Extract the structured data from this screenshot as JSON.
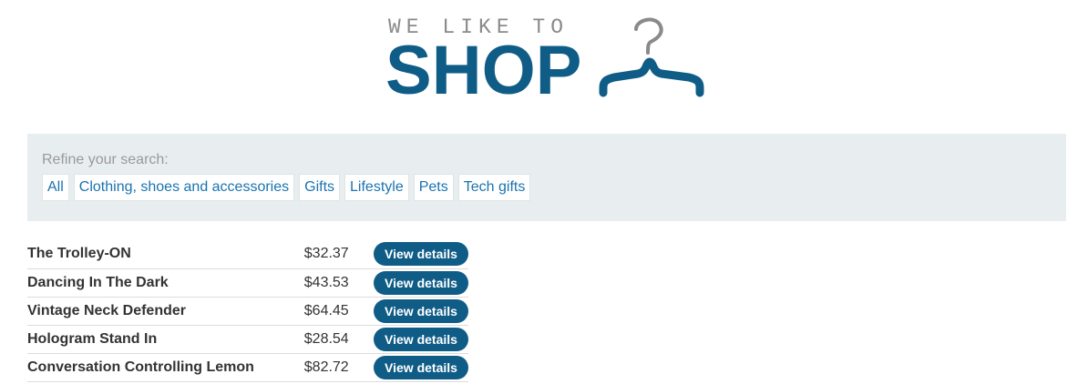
{
  "logo": {
    "tagline": "WE LIKE TO",
    "word": "SHOP",
    "icon": "hanger-icon",
    "colors": {
      "tagline": "#8a8a8a",
      "word": "#0f5c87",
      "hanger_hook": "#8a8a8a",
      "hanger_bar": "#0f5c87"
    }
  },
  "filters": {
    "label": "Refine your search:",
    "options": [
      {
        "label": "All"
      },
      {
        "label": "Clothing, shoes and accessories"
      },
      {
        "label": "Gifts"
      },
      {
        "label": "Lifestyle"
      },
      {
        "label": "Pets"
      },
      {
        "label": "Tech gifts"
      }
    ]
  },
  "products": [
    {
      "name": "The Trolley-ON",
      "price": "$32.37",
      "action": "View details"
    },
    {
      "name": "Dancing In The Dark",
      "price": "$43.53",
      "action": "View details"
    },
    {
      "name": "Vintage Neck Defender",
      "price": "$64.45",
      "action": "View details"
    },
    {
      "name": "Hologram Stand In",
      "price": "$28.54",
      "action": "View details"
    },
    {
      "name": "Conversation Controlling Lemon",
      "price": "$82.72",
      "action": "View details"
    }
  ],
  "theme": {
    "primary": "#0f5c87",
    "panel_background": "#e8eef0",
    "link": "#1a73b0"
  }
}
